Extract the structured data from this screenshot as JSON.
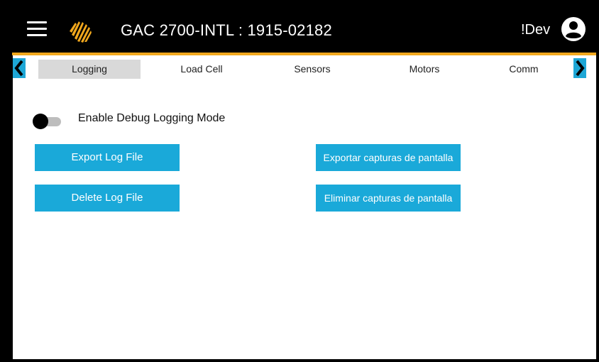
{
  "header": {
    "title": "GAC 2700-INTL : 1915-02182",
    "dev_label": "!Dev",
    "menu_icon": "hamburger-menu-icon",
    "logo_icon": "gac-logo-icon",
    "account_icon": "account-circle-icon",
    "accent_color": "#f2a81d"
  },
  "tabs": [
    {
      "label": "Logging",
      "active": true
    },
    {
      "label": "Load Cell",
      "active": false
    },
    {
      "label": "Sensors",
      "active": false
    },
    {
      "label": "Motors",
      "active": false
    },
    {
      "label": "Comm",
      "active": false
    }
  ],
  "debug_toggle": {
    "label": "Enable Debug Logging Mode",
    "on": false
  },
  "buttons": {
    "export_log": "Export Log File",
    "delete_log": "Delete Log File",
    "export_screenshots": "Exportar capturas de pantalla",
    "delete_screenshots": "Eliminar capturas de pantalla"
  },
  "colors": {
    "button": "#1aa9d9",
    "active_tab": "#d9d9d9"
  }
}
